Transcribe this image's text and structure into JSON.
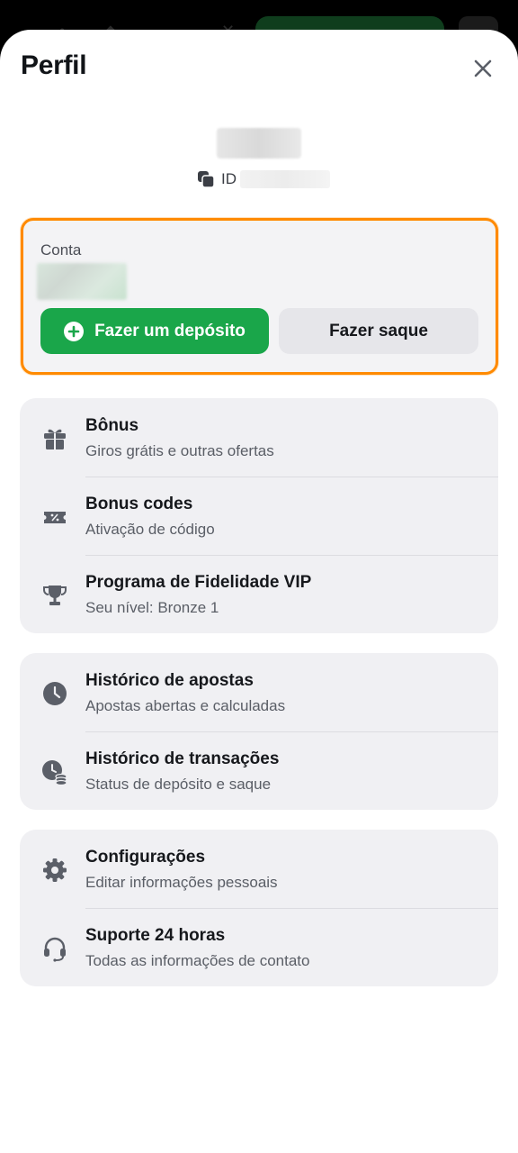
{
  "sheet": {
    "title": "Perfil"
  },
  "profile": {
    "id_label": "ID"
  },
  "account": {
    "label": "Conta",
    "deposit_label": "Fazer um depósito",
    "withdraw_label": "Fazer saque"
  },
  "menu_groups": [
    {
      "items": [
        {
          "icon": "gift-icon",
          "title": "Bônus",
          "subtitle": "Giros grátis e outras ofertas"
        },
        {
          "icon": "coupon-icon",
          "title": "Bonus codes",
          "subtitle": "Ativação de código"
        },
        {
          "icon": "trophy-icon",
          "title": "Programa de Fidelidade VIP",
          "subtitle": "Seu nível: Bronze 1"
        }
      ]
    },
    {
      "items": [
        {
          "icon": "clock-icon",
          "title": "Histórico de apostas",
          "subtitle": "Apostas abertas e calculadas"
        },
        {
          "icon": "transaction-history-icon",
          "title": "Histórico de transações",
          "subtitle": "Status de depósito e saque"
        }
      ]
    },
    {
      "items": [
        {
          "icon": "gear-icon",
          "title": "Configurações",
          "subtitle": "Editar informações pessoais"
        },
        {
          "icon": "headset-icon",
          "title": "Suporte 24 horas",
          "subtitle": "Todas as informações de contato"
        }
      ]
    }
  ],
  "colors": {
    "accent_green": "#1aa64a",
    "highlight_orange": "#ff8a00",
    "icon_gray": "#5b5f68"
  }
}
